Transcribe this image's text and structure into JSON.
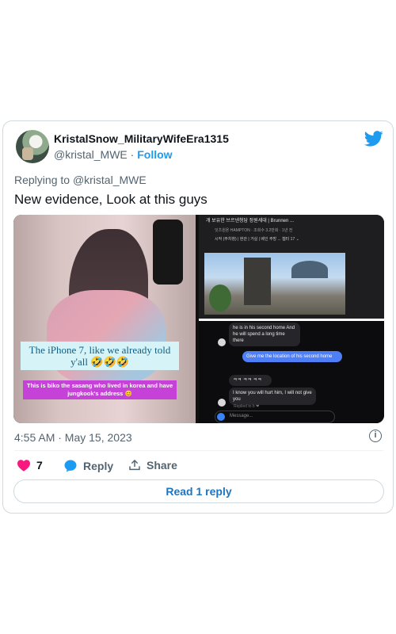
{
  "author": {
    "display_name": "KristalSnow_MilitaryWifeEra1315",
    "handle": "@kristal_MWE",
    "follow_label": "Follow"
  },
  "brand_icon": "twitter-bird-icon",
  "replying_to": {
    "prefix": "Replying to",
    "handle": "@kristal_MWE"
  },
  "tweet": {
    "text": "New evidence, Look at this guys",
    "timestamp": "4:55 AM · May 15, 2023"
  },
  "media": {
    "left_caption_main": "The iPhone 7, like we already told y'all 🤣🤣🤣",
    "left_caption_sub": "This is biko the sasang who lived in korea and have jungkook's address 😊",
    "listing_title": "개 보유한 브르넨청담 정원세대 | Brunnen ...",
    "listing_sub": "잇츠원욘 HAMPTON · 조회수 3.2만회 · 1년 전",
    "listing_tags": "시작 (주차창) | 현관 | 거실 | 베인 주방 ... 챕터 17 ⌄",
    "chat": {
      "msg1": "he is in his second home And he will spend a long time there",
      "msg2": "Give me the location of his second home",
      "msg3": "ㅋㅋ ㅋㅋ ㅋㅋ",
      "msg4": "I know you will hurt him, I will not give you",
      "msg5": "Replied to b ❤",
      "placeholder": "Message..."
    }
  },
  "actions": {
    "like_count": "7",
    "reply_label": "Reply",
    "share_label": "Share"
  },
  "read_replies_label": "Read 1 reply",
  "colors": {
    "accent": "#1d9bf0",
    "like": "#f91880",
    "muted": "#536471",
    "border": "#cfd9de"
  }
}
